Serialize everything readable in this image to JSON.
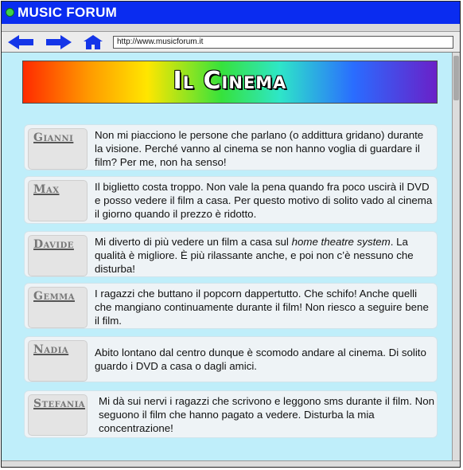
{
  "window": {
    "title": "MUSIC FORUM"
  },
  "nav": {
    "back_icon": "back-arrow-icon",
    "forward_icon": "forward-arrow-icon",
    "home_icon": "home-icon",
    "url": "http://www.musicforum.it"
  },
  "colors": {
    "titlebar": "#0a2cf0",
    "content_bg": "#bfeefa",
    "post_bg": "#eef3f6",
    "nav_icon": "#1435e8"
  },
  "page": {
    "banner_title": "Il Cinema"
  },
  "posts": [
    {
      "user": "Gianni",
      "text_pre": "Non mi piacciono le persone che parlano (o addittura gridano) durante la visione. Perché vanno al cinema se non hanno voglia di guardare il film? Per me, non ha senso!",
      "text_em": "",
      "text_post": ""
    },
    {
      "user": "Max",
      "text_pre": "Il biglietto costa troppo. Non vale la pena quando fra poco uscirà il DVD e posso vedere il film a casa. Per questo motivo di solito vado al cinema il giorno quando il prezzo è ridotto.",
      "text_em": "",
      "text_post": ""
    },
    {
      "user": "Davide",
      "text_pre": "Mi diverto di più vedere un film a casa sul ",
      "text_em": "home theatre system",
      "text_post": ". La qualità è migliore. È più rilassante anche, e poi non c’è nessuno che disturba!"
    },
    {
      "user": "Gemma",
      "text_pre": "I ragazzi che buttano il popcorn dappertutto. Che schifo! Anche quelli che mangiano continuamente durante il film! Non riesco a seguire bene il film.",
      "text_em": "",
      "text_post": ""
    },
    {
      "user": "Nadia",
      "text_pre": "Abito lontano dal centro dunque è scomodo andare al cinema. Di solito guardo i DVD a casa o dagli amici.",
      "text_em": "",
      "text_post": ""
    },
    {
      "user": "Stefania",
      "text_pre": "Mi dà sui nervi i ragazzi che scrivono e leggono sms durante il film. Non seguono il film che hanno pagato a vedere. Disturba la mia concentrazione!",
      "text_em": "",
      "text_post": ""
    }
  ]
}
